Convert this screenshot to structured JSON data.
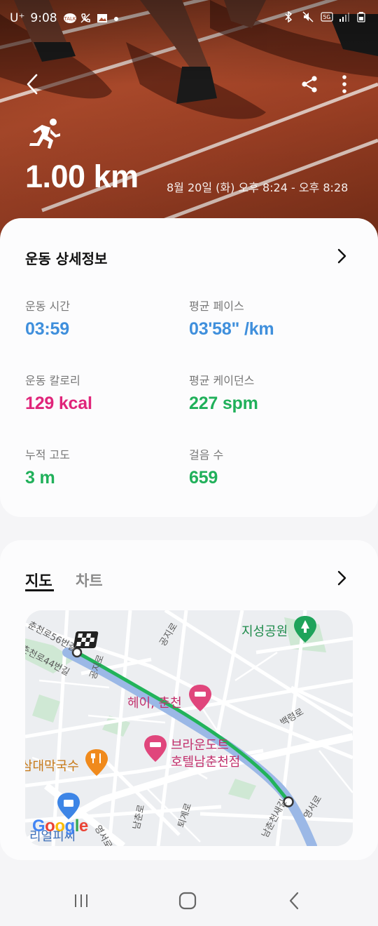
{
  "status_bar": {
    "carrier": "U⁺",
    "time": "9:08",
    "network": "5G"
  },
  "hero": {
    "distance": "1.00 km",
    "datetime": "8월 20일 (화) 오후 8:24 - 오후 8:28"
  },
  "details": {
    "title": "운동 상세정보",
    "metrics": [
      {
        "label": "운동 시간",
        "value": "03:59",
        "color": "#3f8fdc"
      },
      {
        "label": "평균 페이스",
        "value": "03'58\" /km",
        "color": "#3f8fdc"
      },
      {
        "label": "운동 칼로리",
        "value": "129 kcal",
        "color": "#e0257a"
      },
      {
        "label": "평균 케이던스",
        "value": "227 spm",
        "color": "#20b05a"
      },
      {
        "label": "누적 고도",
        "value": "3 m",
        "color": "#20b05a"
      },
      {
        "label": "걸음 수",
        "value": "659",
        "color": "#20b05a"
      }
    ]
  },
  "map_card": {
    "tabs": [
      {
        "label": "지도",
        "selected": true
      },
      {
        "label": "차트",
        "selected": false
      }
    ],
    "map": {
      "labels": {
        "road_1": "춘천로56번길",
        "road_2": "춘천로44번길",
        "road_3": "공지로",
        "road_4": "공지로",
        "road_5": "백령로",
        "road_6": "남춘로",
        "road_7": "퇴계로",
        "road_8": "영서로",
        "road_9": "남춘천새길",
        "road_10": "영서로",
        "park": "지성공원",
        "hotel_1": "헤이, 춘천",
        "hotel_2_line1": "브라운도트",
        "hotel_2_line2": "호텔남춘천점",
        "restaurant": "삼대막국수",
        "shop": "리얼피씨",
        "attribution": "Google"
      },
      "route_color": "#22b35a"
    }
  },
  "icons": {
    "back": "back-arrow-icon",
    "share": "share-icon",
    "more": "more-vert-icon",
    "activity": "running-icon",
    "chevron": "chevron-right-icon"
  }
}
